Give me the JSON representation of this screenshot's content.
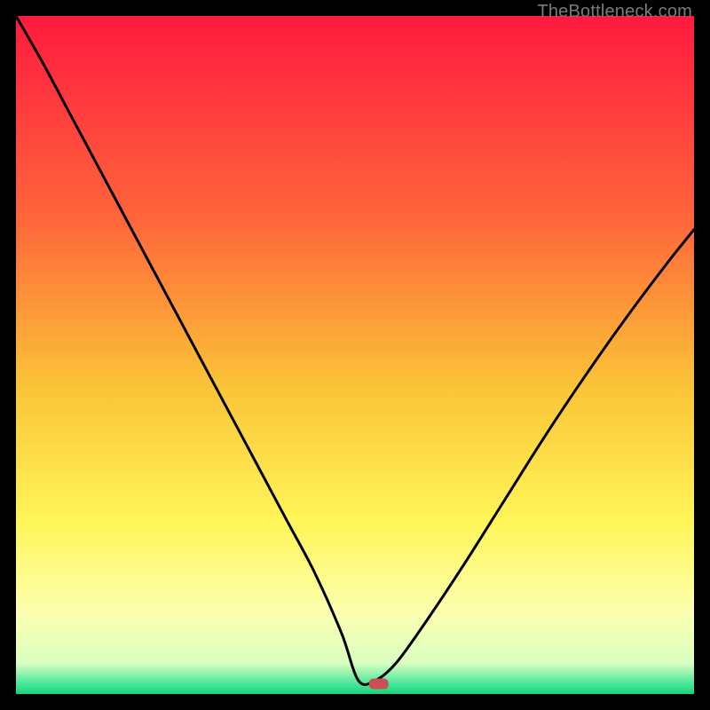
{
  "watermark": "TheBottleneck.com",
  "chart_data": {
    "type": "line",
    "title": "",
    "xlabel": "",
    "ylabel": "",
    "xlim": [
      0,
      100
    ],
    "ylim": [
      0,
      100
    ],
    "grid": false,
    "legend": false,
    "background_gradient": {
      "stops": [
        {
          "offset": 0.0,
          "color": "#ff1a3f"
        },
        {
          "offset": 0.3,
          "color": "#ff663a"
        },
        {
          "offset": 0.55,
          "color": "#fbc538"
        },
        {
          "offset": 0.75,
          "color": "#fff65a"
        },
        {
          "offset": 0.88,
          "color": "#fcffb0"
        },
        {
          "offset": 0.955,
          "color": "#d8ffc0"
        },
        {
          "offset": 0.985,
          "color": "#48e69a"
        },
        {
          "offset": 1.0,
          "color": "#18d27a"
        }
      ]
    },
    "marker": {
      "x": 53.5,
      "y": 1.5,
      "color": "#c94f55"
    },
    "series": [
      {
        "name": "bottleneck-curve",
        "x": [
          0,
          4,
          8,
          12,
          16,
          20,
          24,
          28,
          32,
          36,
          40,
          44,
          48,
          50.5,
          53,
          56,
          60,
          66,
          72,
          78,
          84,
          90,
          96,
          100
        ],
        "y": [
          100,
          93,
          85.5,
          78,
          70.5,
          63,
          55.5,
          48,
          40.5,
          33,
          25.5,
          18,
          9,
          2,
          2,
          4.5,
          10,
          19,
          28.5,
          38,
          47,
          55.5,
          63.5,
          68.5
        ]
      }
    ]
  }
}
